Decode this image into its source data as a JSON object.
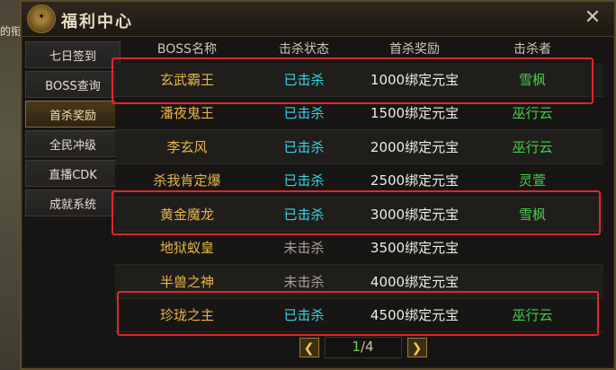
{
  "background": {
    "left_text": "的衔"
  },
  "window": {
    "title": "福利中心",
    "emblem": "☀"
  },
  "sidebar": {
    "items": [
      {
        "label": "七日签到",
        "active": false
      },
      {
        "label": "BOSS查询",
        "active": false
      },
      {
        "label": "首杀奖励",
        "active": true
      },
      {
        "label": "全民冲级",
        "active": false
      },
      {
        "label": "直播CDK",
        "active": false
      },
      {
        "label": "成就系统",
        "active": false
      }
    ]
  },
  "table": {
    "headers": {
      "boss": "BOSS名称",
      "status": "击杀状态",
      "reward": "首杀奖励",
      "killer": "击杀者"
    },
    "rows": [
      {
        "boss": "玄武霸王",
        "status": "已击杀",
        "reward": "1000绑定元宝",
        "killer": "雪枫"
      },
      {
        "boss": "潘夜鬼王",
        "status": "已击杀",
        "reward": "1500绑定元宝",
        "killer": "巫行云"
      },
      {
        "boss": "李玄风",
        "status": "已击杀",
        "reward": "2000绑定元宝",
        "killer": "巫行云"
      },
      {
        "boss": "杀我肯定爆",
        "status": "已击杀",
        "reward": "2500绑定元宝",
        "killer": "灵萱"
      },
      {
        "boss": "黄金魔龙",
        "status": "已击杀",
        "reward": "3000绑定元宝",
        "killer": "雪枫"
      },
      {
        "boss": "地狱蚁皇",
        "status": "未击杀",
        "reward": "3500绑定元宝",
        "killer": ""
      },
      {
        "boss": "半兽之神",
        "status": "未击杀",
        "reward": "4000绑定元宝",
        "killer": ""
      },
      {
        "boss": "珍珑之主",
        "status": "已击杀",
        "reward": "4500绑定元宝",
        "killer": "巫行云"
      }
    ]
  },
  "pager": {
    "prev": "❮",
    "next": "❯",
    "current": "1",
    "separator": "/",
    "total": "4"
  },
  "colors": {
    "boss": "#e6b34a",
    "killed": "#37d6e6",
    "not_killed": "#a8a39a",
    "killer": "#3fd24a",
    "highlight": "#e0262a"
  }
}
